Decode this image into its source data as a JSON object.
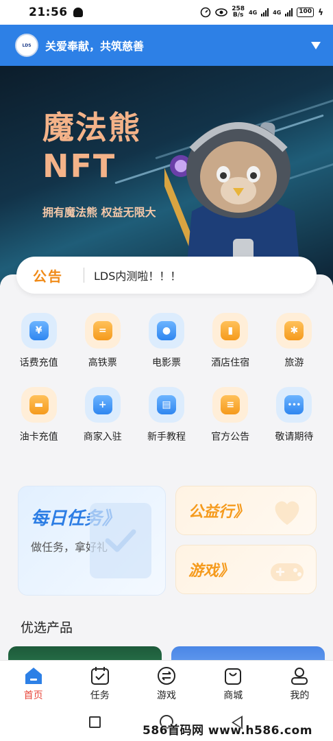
{
  "status_bar": {
    "time": "21:56",
    "net_speed_value": "258",
    "net_speed_unit": "B/s",
    "network_1": "4G",
    "network_2": "4G",
    "battery": "100"
  },
  "header": {
    "logo_text": "LDS",
    "title": "关爱奉献，共筑慈善"
  },
  "banner": {
    "title_line1": "魔法熊",
    "title_line2": "NFT",
    "subtitle": "拥有魔法熊 权益无限大"
  },
  "notice": {
    "tag": "公告",
    "text": "LDS内测啦！！！"
  },
  "grid": [
    {
      "label": "话费充值",
      "icon": "phone-recharge-icon",
      "color": "blue",
      "glyph": "¥"
    },
    {
      "label": "高铁票",
      "icon": "train-ticket-icon",
      "color": "orange",
      "glyph": "="
    },
    {
      "label": "电影票",
      "icon": "film-reel-icon",
      "color": "blue",
      "glyph": "●"
    },
    {
      "label": "酒店住宿",
      "icon": "hotel-icon",
      "color": "orange",
      "glyph": "▮"
    },
    {
      "label": "旅游",
      "icon": "palm-tree-icon",
      "color": "orange",
      "glyph": "✱"
    },
    {
      "label": "油卡充值",
      "icon": "fuel-card-icon",
      "color": "orange",
      "glyph": "▬"
    },
    {
      "label": "商家入驻",
      "icon": "merchant-join-icon",
      "color": "blue",
      "glyph": "+"
    },
    {
      "label": "新手教程",
      "icon": "tutorial-book-icon",
      "color": "blue",
      "glyph": "▤"
    },
    {
      "label": "官方公告",
      "icon": "official-notice-icon",
      "color": "orange",
      "glyph": "≡"
    },
    {
      "label": "敬请期待",
      "icon": "more-dots-icon",
      "color": "blue",
      "glyph": "•••"
    }
  ],
  "cards": {
    "daily_title": "每日任务》",
    "daily_sub": "做任务，拿好礼",
    "charity_title": "公益行》",
    "game_title": "游戏》"
  },
  "section_title": "优选产品",
  "tabbar": [
    {
      "label": "首页",
      "icon": "home-icon",
      "active": true
    },
    {
      "label": "任务",
      "icon": "task-calendar-icon",
      "active": false
    },
    {
      "label": "游戏",
      "icon": "game-exchange-icon",
      "active": false
    },
    {
      "label": "商城",
      "icon": "shop-bag-icon",
      "active": false
    },
    {
      "label": "我的",
      "icon": "profile-icon",
      "active": false
    }
  ],
  "watermark": "586首码网 www.h586.com",
  "colors": {
    "brand_blue": "#2d80e6",
    "accent_orange": "#f59a1c",
    "active_red": "#e8473b"
  }
}
